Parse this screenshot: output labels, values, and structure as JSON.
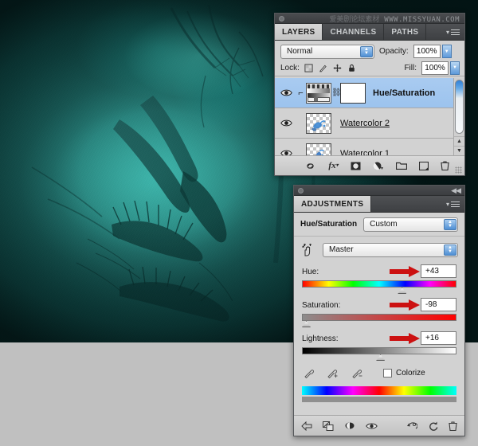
{
  "app": {
    "watermark_cn": "爱美剧论坛素材",
    "watermark_url": "WWW.MISSYUAN.COM"
  },
  "canvas": {
    "name": "artwork-canvas",
    "description": "Underwater teal image with dark organic plant-like forms"
  },
  "layers_panel": {
    "tabs": [
      {
        "label": "LAYERS",
        "active": true
      },
      {
        "label": "CHANNELS",
        "active": false
      },
      {
        "label": "PATHS",
        "active": false
      }
    ],
    "blend_mode": "Normal",
    "opacity_label": "Opacity:",
    "opacity_value": "100%",
    "lock_label": "Lock:",
    "fill_label": "Fill:",
    "fill_value": "100%",
    "lock_icons": [
      "lock-transparency-icon",
      "lock-image-icon",
      "lock-position-icon",
      "lock-all-icon"
    ],
    "layers": [
      {
        "name": "Hue/Saturation",
        "selected": true,
        "type": "adjustment",
        "visible": true,
        "clipped": true,
        "bold": true,
        "underline": false
      },
      {
        "name": "Watercolor 2",
        "selected": false,
        "type": "pixel",
        "visible": true,
        "clipped": false,
        "bold": false,
        "underline": true
      },
      {
        "name": "Watercolor 1",
        "selected": false,
        "type": "pixel",
        "visible": true,
        "clipped": false,
        "bold": false,
        "underline": false
      }
    ],
    "bottom_icons": [
      "link-layers-icon",
      "layer-style-fx-icon",
      "add-layer-mask-icon",
      "new-fill-adjustment-icon",
      "new-group-icon",
      "new-layer-icon",
      "delete-layer-icon"
    ]
  },
  "adjustments_panel": {
    "tab_label": "ADJUSTMENTS",
    "title": "Hue/Saturation",
    "preset_value": "Custom",
    "channel_value": "Master",
    "sliders": [
      {
        "label": "Hue:",
        "value": "+43",
        "percent": 62,
        "track": "hue"
      },
      {
        "label": "Saturation:",
        "value": "-98",
        "percent": 1,
        "track": "sat"
      },
      {
        "label": "Lightness:",
        "value": "+16",
        "percent": 48,
        "track": "light"
      }
    ],
    "eyedroppers": [
      "eyedropper-icon",
      "eyedropper-add-icon",
      "eyedropper-subtract-icon"
    ],
    "colorize_label": "Colorize",
    "colorize_checked": false,
    "bottom_icons": [
      "return-to-adjustment-list-icon",
      "clip-to-layer-icon",
      "toggle-layer-mask-icon",
      "preview-eye-icon",
      "reset-previous-icon",
      "reset-adjustment-icon",
      "delete-adjustment-icon"
    ]
  },
  "colors": {
    "panel_bg": "#d2d2d2",
    "panel_chrome": "#44464a",
    "selection_blue": "#a9cbf0",
    "accent_red": "#cc1111",
    "teal": "#2e8d86",
    "floor_gray": "#c0c0c0"
  }
}
